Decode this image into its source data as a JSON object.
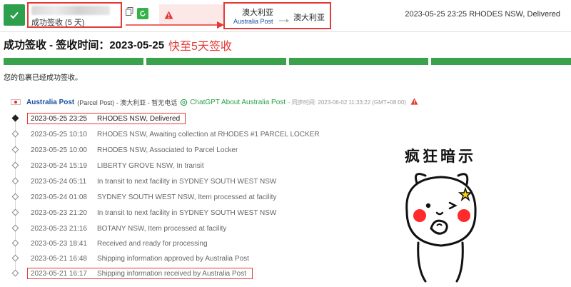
{
  "header": {
    "status_days": "成功签收 (5 天)",
    "carrier_name_zh": "澳大利亚",
    "carrier_name_en": "Australia Post",
    "destination": "澳大利亚",
    "latest_event": "2023-05-25 23:25  RHODES NSW, Delivered"
  },
  "headline": {
    "title": "成功签收 - 签收时间：2023-05-25",
    "annotation": "快至5天签收"
  },
  "progress": {
    "completed_segments": 4,
    "total_segments": 4
  },
  "delivered_message": "您的包裹已经成功签收。",
  "carrier_line": {
    "name": "Australia Post",
    "service": "(Parcel Post) - 澳大利亚 - 暂无电话",
    "chatgpt_link": "ChatGPT About Australia Post",
    "sync_time": "- 同步时间: 2023-06-02 11:33:22 (GMT+08:00)"
  },
  "events": [
    {
      "time": "2023-05-25 23:25",
      "desc": "RHODES NSW, Delivered"
    },
    {
      "time": "2023-05-25 10:10",
      "desc": "RHODES NSW, Awaiting collection at RHODES #1 PARCEL LOCKER"
    },
    {
      "time": "2023-05-25 10:00",
      "desc": "RHODES NSW, Associated to Parcel Locker"
    },
    {
      "time": "2023-05-24 15:19",
      "desc": "LIBERTY GROVE NSW, In transit"
    },
    {
      "time": "2023-05-24 05:11",
      "desc": "In transit to next facility in SYDNEY SOUTH WEST NSW"
    },
    {
      "time": "2023-05-24 01:08",
      "desc": "SYDNEY SOUTH WEST NSW, Item processed at facility"
    },
    {
      "time": "2023-05-23 21:20",
      "desc": "In transit to next facility in SYDNEY SOUTH WEST NSW"
    },
    {
      "time": "2023-05-23 21:16",
      "desc": "BOTANY NSW, Item processed at facility"
    },
    {
      "time": "2023-05-23 18:41",
      "desc": "Received and ready for processing"
    },
    {
      "time": "2023-05-21 16:48",
      "desc": "Shipping information approved by Australia Post"
    },
    {
      "time": "2023-05-21 16:17",
      "desc": "Shipping information received by Australia Post"
    }
  ],
  "sticker": {
    "text": "疯狂暗示"
  },
  "colors": {
    "accent_green": "#2e9f4c",
    "highlight_red": "#e53935",
    "link_blue": "#1a4fa0"
  }
}
